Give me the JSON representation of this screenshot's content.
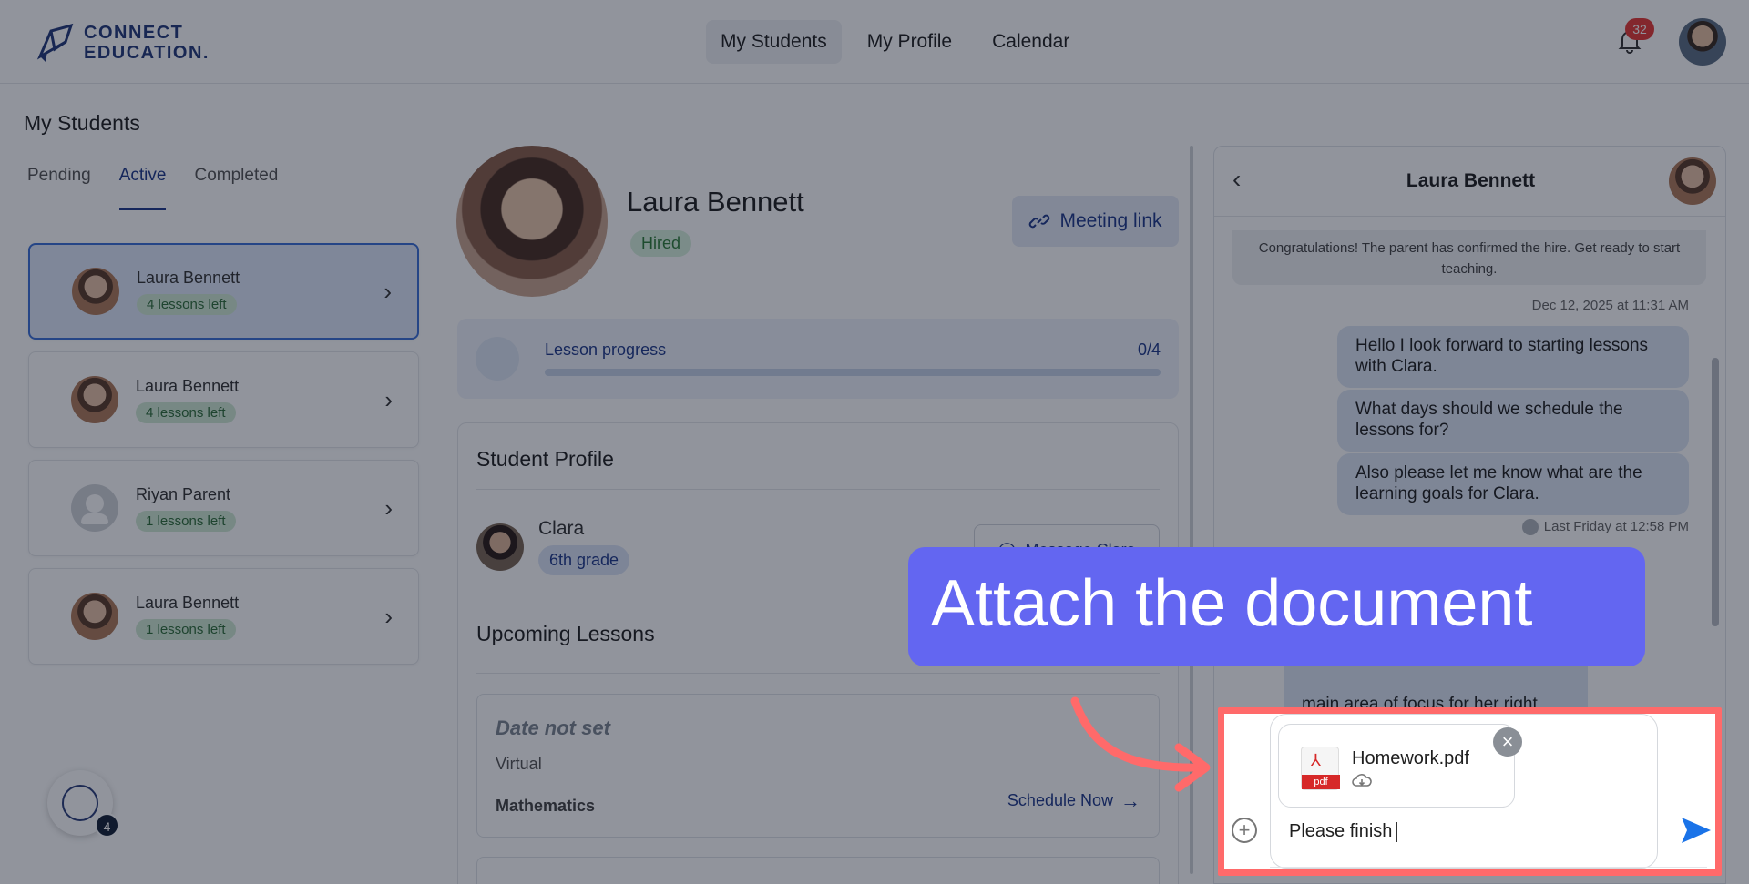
{
  "header": {
    "logo_line1": "CONNECT",
    "logo_line2": "EDUCATION.",
    "nav": [
      {
        "label": "My Students",
        "active": true
      },
      {
        "label": "My Profile",
        "active": false
      },
      {
        "label": "Calendar",
        "active": false
      }
    ],
    "notification_count": "32",
    "icons": {
      "bell": "bell-icon",
      "avatar": "user-avatar"
    }
  },
  "sidebar": {
    "title": "My Students",
    "tabs": [
      {
        "label": "Pending",
        "active": false
      },
      {
        "label": "Active",
        "active": true
      },
      {
        "label": "Completed",
        "active": false
      }
    ],
    "students": [
      {
        "name": "Laura Bennett",
        "lessons": "4 lessons left",
        "selected": true
      },
      {
        "name": "Laura Bennett",
        "lessons": "4 lessons left",
        "selected": false
      },
      {
        "name": "Riyan Parent",
        "lessons": "1 lessons left",
        "selected": false
      },
      {
        "name": "Laura Bennett",
        "lessons": "1 lessons left",
        "selected": false
      }
    ],
    "fab_badge": "4"
  },
  "profile": {
    "name": "Laura Bennett",
    "status": "Hired",
    "meeting_link_label": "Meeting link",
    "progress_label": "Lesson progress",
    "progress_count": "0/4",
    "progress_fraction": 0,
    "student_profile_title": "Student Profile",
    "child_name": "Clara",
    "child_grade": "6th grade",
    "message_button": "Message Clara",
    "upcoming_title": "Upcoming Lessons",
    "lesson": {
      "date": "Date not set",
      "type": "Virtual",
      "subject": "Mathematics",
      "schedule_label": "Schedule Now"
    }
  },
  "chat": {
    "title": "Laura Bennett",
    "system_message": "Congratulations! The parent has confirmed the hire. Get ready to start teaching.",
    "system_timestamp": "Dec 12, 2025 at 11:31 AM",
    "messages": [
      "Hello I look forward to starting lessons with Clara.",
      "What days should we schedule the lessons for?",
      "Also please let me know what are the learning goals for Clara."
    ],
    "messages_timestamp": "Last Friday at 12:58 PM",
    "partial_message": "main area of focus for her right",
    "composer": {
      "attachment_name": "Homework.pdf",
      "pdf_label": "pdf",
      "text": "Please finish"
    }
  },
  "callout": {
    "text": "Attach the document",
    "color": "#6366f1",
    "highlight_color": "#ff6a6a"
  },
  "colors": {
    "brand": "#233a7a",
    "accent": "#1f3a8a",
    "success_bg": "#cfe9d3",
    "notification": "#e53935"
  }
}
